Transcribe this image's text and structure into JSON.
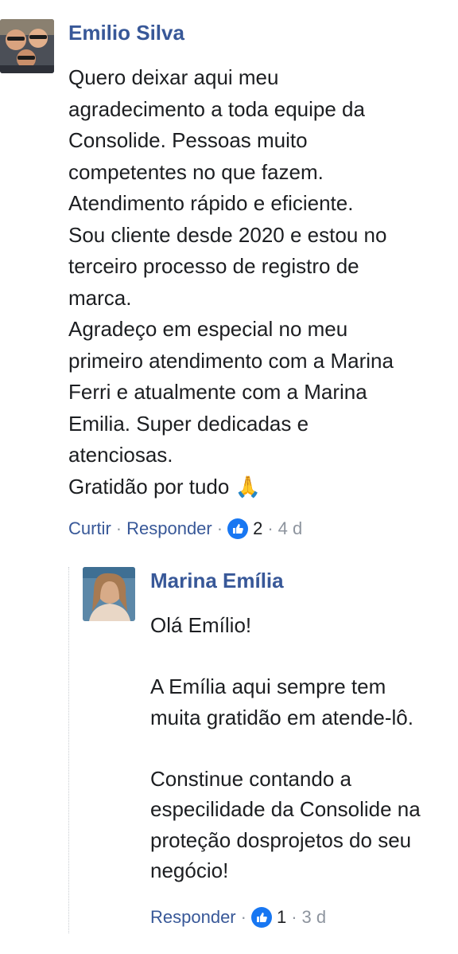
{
  "comment": {
    "author": "Emilio Silva",
    "text": "Quero deixar aqui meu\nagradecimento a toda equipe da\nConsolide. Pessoas muito\ncompetentes no que fazem.\nAtendimento rápido e eficiente.\nSou cliente desde 2020 e estou no\nterceiro processo de registro de\nmarca.\nAgradeço em especial no meu\nprimeiro atendimento com a Marina\nFerri e atualmente com a Marina\nEmilia. Super dedicadas e\natenciosas.\nGratidão por tudo 🙏",
    "actions": {
      "like_label": "Curtir",
      "reply_label": "Responder",
      "separator": "·",
      "reactions_count": "2",
      "time": "4 d"
    }
  },
  "reply": {
    "author": "Marina Emília",
    "text": "Olá Emílio!\n\nA Emília aqui sempre tem\nmuita gratidão em atende-lô.\n\nConstinue contando a\nespecilidade da Consolide na\nproteção dosprojetos do seu\nnegócio!",
    "actions": {
      "reply_label": "Responder",
      "separator": "·",
      "reactions_count": "1",
      "time": "3 d"
    }
  },
  "colors": {
    "link": "#385898",
    "meta": "#8d949e",
    "like_blue": "#1877f2"
  },
  "icons": [
    "avatar-photo",
    "like-reaction-icon",
    "folded-hands-emoji"
  ]
}
